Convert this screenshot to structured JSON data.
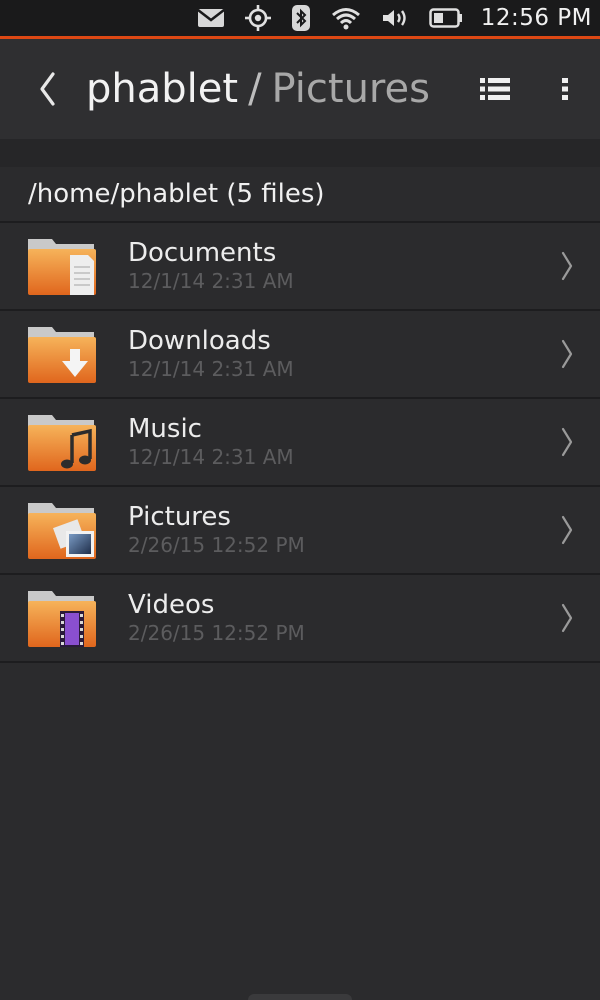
{
  "status_bar": {
    "time": "12:56 PM",
    "icons": [
      "mail-icon",
      "location-icon",
      "bluetooth-icon",
      "wifi-icon",
      "volume-icon",
      "battery-icon"
    ]
  },
  "header": {
    "parent": "phablet",
    "separator": "/",
    "current": "Pictures",
    "actions": [
      "list-view-icon",
      "overflow-menu-icon"
    ]
  },
  "path_header": {
    "label": "/home/phablet (5 files)"
  },
  "items": [
    {
      "name": "Documents",
      "date": "12/1/14 2:31 AM",
      "icon": "documents-folder-icon"
    },
    {
      "name": "Downloads",
      "date": "12/1/14 2:31 AM",
      "icon": "downloads-folder-icon"
    },
    {
      "name": "Music",
      "date": "12/1/14 2:31 AM",
      "icon": "music-folder-icon"
    },
    {
      "name": "Pictures",
      "date": "2/26/15 12:52 PM",
      "icon": "pictures-folder-icon"
    },
    {
      "name": "Videos",
      "date": "2/26/15 12:52 PM",
      "icon": "videos-folder-icon"
    }
  ],
  "colors": {
    "accent": "#dd4814",
    "folder_top": "#f6b35a",
    "folder_bottom": "#e0661d",
    "background": "#2b2b2d"
  }
}
